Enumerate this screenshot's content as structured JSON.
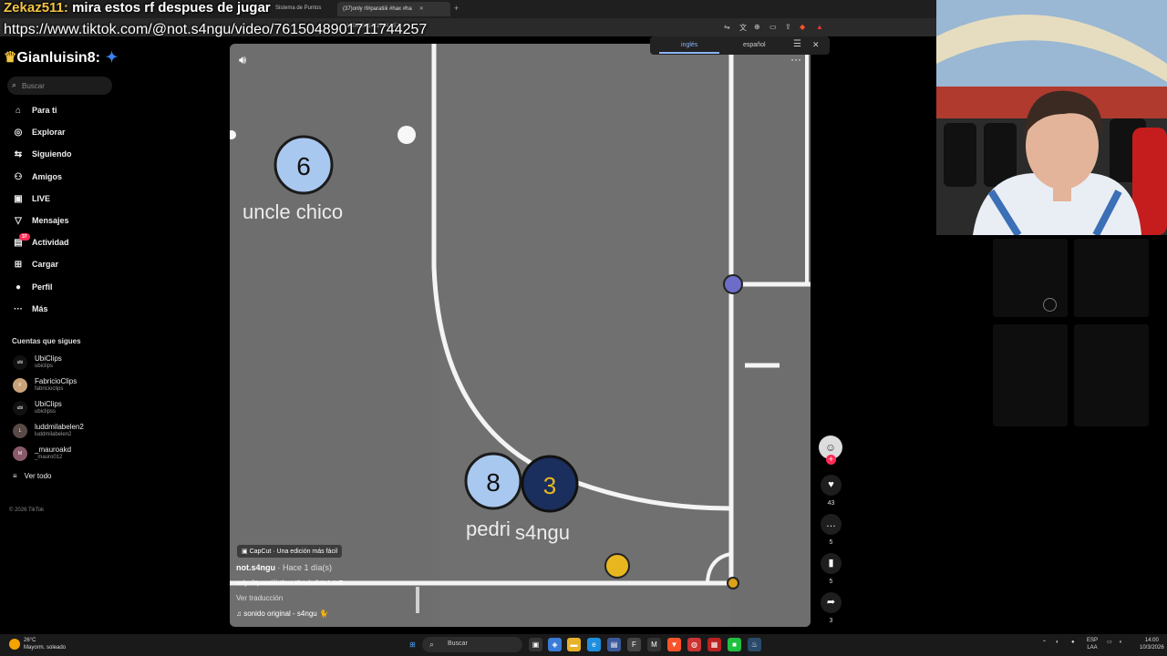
{
  "browser": {
    "tabs": [
      {
        "label": "Sistema de Puntos"
      },
      {
        "label": "(37)only rf#paratiiii #hax #ha"
      }
    ],
    "url": "150489017117442 57"
  },
  "overlay": {
    "chat_user": "Zekaz511:",
    "chat_msg": "mira estos rf despues de jugar",
    "url": "https://www.tiktok.com/@not.s4ngu/video/7615048901711744257",
    "streamer": "Gianluisin8:"
  },
  "translate_popup": {
    "lang1": "inglés",
    "lang2": "español"
  },
  "sidebar": {
    "search_placeholder": "Buscar",
    "nav": [
      {
        "label": "Para ti",
        "icon": "home-icon"
      },
      {
        "label": "Explorar",
        "icon": "compass-icon"
      },
      {
        "label": "Siguiendo",
        "icon": "following-icon"
      },
      {
        "label": "Amigos",
        "icon": "friends-icon"
      },
      {
        "label": "LIVE",
        "icon": "live-icon"
      },
      {
        "label": "Mensajes",
        "icon": "messages-icon"
      },
      {
        "label": "Actividad",
        "icon": "activity-icon",
        "badge": "37"
      },
      {
        "label": "Cargar",
        "icon": "upload-icon"
      },
      {
        "label": "Perfil",
        "icon": "profile-icon"
      },
      {
        "label": "Más",
        "icon": "more-icon"
      }
    ],
    "following_title": "Cuentas que sigues",
    "accounts": [
      {
        "name": "UbiClips",
        "handle": "ubiclips",
        "av": "ubi"
      },
      {
        "name": "FabricioClips",
        "handle": "fabricioclips",
        "av": "F"
      },
      {
        "name": "UbiClips",
        "handle": "ubiclipss",
        "av": "ubi"
      },
      {
        "name": "luddmilabelen2",
        "handle": "luddmilabelen2",
        "av": "L"
      },
      {
        "name": "_mauroakd",
        "handle": "_mauro012",
        "av": "M"
      }
    ],
    "see_all": "Ver todo",
    "copyright": "© 2026 TikTok"
  },
  "video": {
    "players": [
      {
        "number": "6",
        "name": "uncle chico"
      },
      {
        "number": "8",
        "name": "pedri"
      },
      {
        "number": "3",
        "name": "s4ngu"
      }
    ],
    "capcut": "CapCut · Una edición más fácil",
    "author": "not.s4ngu",
    "time": "· Hace 1 día(s)",
    "description": "only rf#paratiiii #hax #haxball #x1 #x7",
    "translate": "Ver traducción",
    "sound": "sonido original - s4ngu 🐈"
  },
  "rail": {
    "likes": "43",
    "comments": "5",
    "saves": "5",
    "shares": "3"
  },
  "taskbar": {
    "temp": "26°C",
    "weather": "Mayorm. soleado",
    "search": "Buscar",
    "lang": "ESP",
    "lang2": "LAA",
    "time": "14:00",
    "date": "10/3/2026"
  },
  "colors": {
    "accent": "#fe2c55",
    "team_blue": "#a9c8f0",
    "team_dark": "#1b2f5e",
    "ball_yellow": "#e8b720"
  }
}
